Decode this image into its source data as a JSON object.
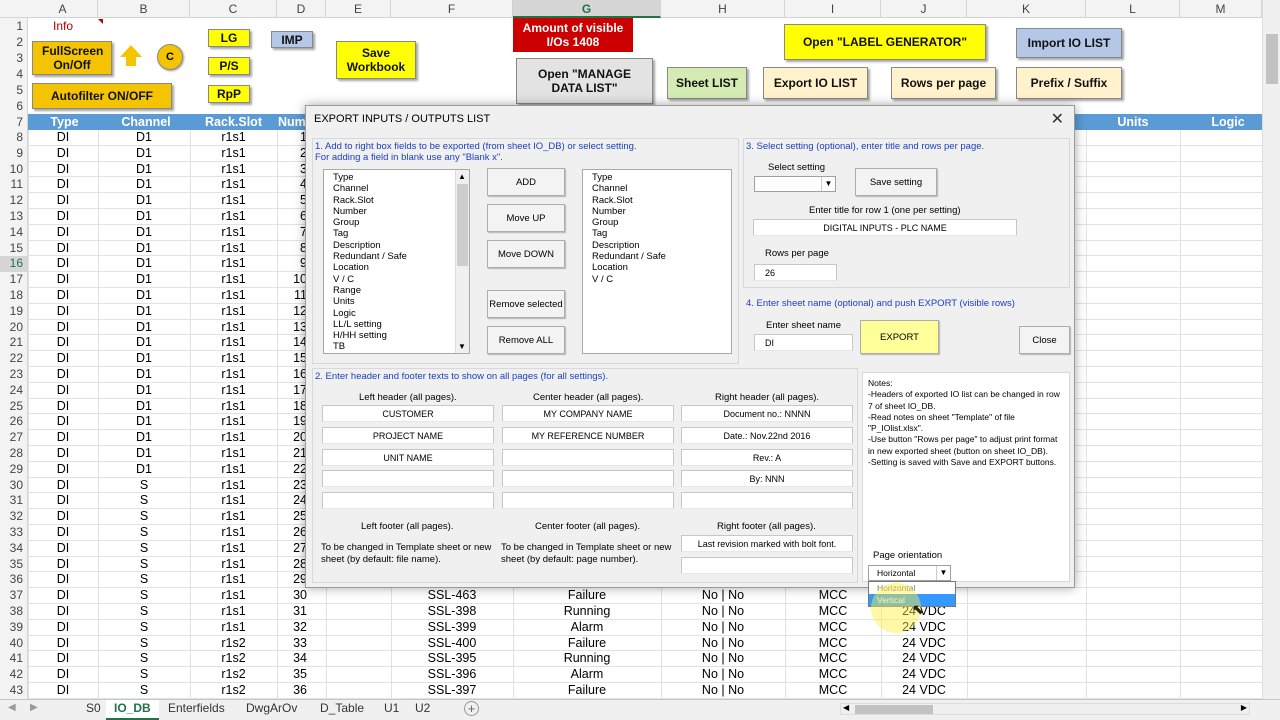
{
  "info_label": "Info",
  "columns": [
    "A",
    "B",
    "C",
    "D",
    "E",
    "F",
    "G",
    "H",
    "I",
    "J",
    "K",
    "L",
    "M"
  ],
  "selected_column": "G",
  "header_row": {
    "type": "Type",
    "channel": "Channel",
    "rack": "Rack.Slot",
    "num": "Num",
    "units": "Units",
    "logic": "Logic"
  },
  "top_buttons": {
    "fullscreen": "FullScreen On/Off",
    "autofilter": "Autofilter ON/OFF",
    "c": "C",
    "lg": "LG",
    "ps": "P/S",
    "rpp": "RpP",
    "imp": "IMP",
    "save": "Save Workbook",
    "amount": "Amount of visible I/Os 1408",
    "manage": "Open \"MANAGE DATA LIST\"",
    "sheetlist": "Sheet LIST",
    "exportlist": "Export IO LIST",
    "rowsperpage": "Rows per page",
    "prefix": "Prefix / Suffix",
    "labelgen": "Open \"LABEL GENERATOR\"",
    "importlist": "Import IO LIST"
  },
  "rows": [
    {
      "n": "8",
      "a": "DI",
      "b": "D1",
      "c": "r1s1",
      "d": "1"
    },
    {
      "n": "9",
      "a": "DI",
      "b": "D1",
      "c": "r1s1",
      "d": "2"
    },
    {
      "n": "10",
      "a": "DI",
      "b": "D1",
      "c": "r1s1",
      "d": "3"
    },
    {
      "n": "11",
      "a": "DI",
      "b": "D1",
      "c": "r1s1",
      "d": "4"
    },
    {
      "n": "12",
      "a": "DI",
      "b": "D1",
      "c": "r1s1",
      "d": "5"
    },
    {
      "n": "13",
      "a": "DI",
      "b": "D1",
      "c": "r1s1",
      "d": "6"
    },
    {
      "n": "14",
      "a": "DI",
      "b": "D1",
      "c": "r1s1",
      "d": "7"
    },
    {
      "n": "15",
      "a": "DI",
      "b": "D1",
      "c": "r1s1",
      "d": "8"
    },
    {
      "n": "16",
      "a": "DI",
      "b": "D1",
      "c": "r1s1",
      "d": "9"
    },
    {
      "n": "17",
      "a": "DI",
      "b": "D1",
      "c": "r1s1",
      "d": "10"
    },
    {
      "n": "18",
      "a": "DI",
      "b": "D1",
      "c": "r1s1",
      "d": "11"
    },
    {
      "n": "19",
      "a": "DI",
      "b": "D1",
      "c": "r1s1",
      "d": "12"
    },
    {
      "n": "20",
      "a": "DI",
      "b": "D1",
      "c": "r1s1",
      "d": "13"
    },
    {
      "n": "21",
      "a": "DI",
      "b": "D1",
      "c": "r1s1",
      "d": "14"
    },
    {
      "n": "22",
      "a": "DI",
      "b": "D1",
      "c": "r1s1",
      "d": "15"
    },
    {
      "n": "23",
      "a": "DI",
      "b": "D1",
      "c": "r1s1",
      "d": "16"
    },
    {
      "n": "24",
      "a": "DI",
      "b": "D1",
      "c": "r1s1",
      "d": "17"
    },
    {
      "n": "25",
      "a": "DI",
      "b": "D1",
      "c": "r1s1",
      "d": "18"
    },
    {
      "n": "26",
      "a": "DI",
      "b": "D1",
      "c": "r1s1",
      "d": "19"
    },
    {
      "n": "27",
      "a": "DI",
      "b": "D1",
      "c": "r1s1",
      "d": "20"
    },
    {
      "n": "28",
      "a": "DI",
      "b": "D1",
      "c": "r1s1",
      "d": "21"
    },
    {
      "n": "29",
      "a": "DI",
      "b": "D1",
      "c": "r1s1",
      "d": "22"
    },
    {
      "n": "30",
      "a": "DI",
      "b": "S",
      "c": "r1s1",
      "d": "23"
    },
    {
      "n": "31",
      "a": "DI",
      "b": "S",
      "c": "r1s1",
      "d": "24"
    },
    {
      "n": "32",
      "a": "DI",
      "b": "S",
      "c": "r1s1",
      "d": "25"
    },
    {
      "n": "33",
      "a": "DI",
      "b": "S",
      "c": "r1s1",
      "d": "26"
    },
    {
      "n": "34",
      "a": "DI",
      "b": "S",
      "c": "r1s1",
      "d": "27"
    },
    {
      "n": "35",
      "a": "DI",
      "b": "S",
      "c": "r1s1",
      "d": "28"
    },
    {
      "n": "36",
      "a": "DI",
      "b": "S",
      "c": "r1s1",
      "d": "29"
    },
    {
      "n": "37",
      "a": "DI",
      "b": "S",
      "c": "r1s1",
      "d": "30",
      "f": "SSL-463",
      "g": "Failure",
      "h": "No | No",
      "i": "MCC",
      "j": ""
    },
    {
      "n": "38",
      "a": "DI",
      "b": "S",
      "c": "r1s1",
      "d": "31",
      "f": "SSL-398",
      "g": "Running",
      "h": "No | No",
      "i": "MCC",
      "j": "24 VDC"
    },
    {
      "n": "39",
      "a": "DI",
      "b": "S",
      "c": "r1s1",
      "d": "32",
      "f": "SSL-399",
      "g": "Alarm",
      "h": "No | No",
      "i": "MCC",
      "j": "24 VDC"
    },
    {
      "n": "40",
      "a": "DI",
      "b": "S",
      "c": "r1s2",
      "d": "33",
      "f": "SSL-400",
      "g": "Failure",
      "h": "No | No",
      "i": "MCC",
      "j": "24 VDC"
    },
    {
      "n": "41",
      "a": "DI",
      "b": "S",
      "c": "r1s2",
      "d": "34",
      "f": "SSL-395",
      "g": "Running",
      "h": "No | No",
      "i": "MCC",
      "j": "24 VDC"
    },
    {
      "n": "42",
      "a": "DI",
      "b": "S",
      "c": "r1s2",
      "d": "35",
      "f": "SSL-396",
      "g": "Alarm",
      "h": "No | No",
      "i": "MCC",
      "j": "24 VDC"
    },
    {
      "n": "43",
      "a": "DI",
      "b": "S",
      "c": "r1s2",
      "d": "36",
      "f": "SSL-397",
      "g": "Failure",
      "h": "No | No",
      "i": "MCC",
      "j": "24 VDC"
    }
  ],
  "top_row_numbers": [
    "1",
    "2",
    "3",
    "4",
    "5",
    "6",
    "7"
  ],
  "dialog": {
    "title": "EXPORT INPUTS / OUTPUTS LIST",
    "step1": "1. Add to right box fields to be exported (from sheet IO_DB) or select setting.",
    "step1b": "For adding a field in blank use any \"Blank x\".",
    "left_fields": [
      "Type",
      "Channel",
      "Rack.Slot",
      "Number",
      "Group",
      "Tag",
      "Description",
      "Redundant / Safe",
      "Location",
      "V / C",
      "Range",
      "Units",
      "Logic",
      "LL/L setting",
      "H/HH setting",
      "TB"
    ],
    "right_fields": [
      "Type",
      "Channel",
      "Rack.Slot",
      "Number",
      "Group",
      "Tag",
      "Description",
      "Redundant / Safe",
      "Location",
      "V / C"
    ],
    "add": "ADD",
    "move_up": "Move UP",
    "move_down": "Move DOWN",
    "remove_sel": "Remove selected",
    "remove_all": "Remove ALL",
    "step3": "3. Select setting (optional), enter title and rows per page.",
    "select_setting": "Select setting",
    "save_setting": "Save setting",
    "title_label": "Enter title for row 1 (one per setting)",
    "title_value": "DIGITAL INPUTS - PLC NAME",
    "rows_label": "Rows per page",
    "rows_value": "26",
    "step4": "4. Enter sheet name (optional) and push EXPORT (visible rows)",
    "sheet_label": "Enter sheet name",
    "sheet_value": "DI",
    "export": "EXPORT",
    "close": "Close",
    "step2": "2. Enter header and footer texts to show on all pages (for all settings).",
    "left_header": "Left header (all pages).",
    "center_header": "Center header (all pages).",
    "right_header": "Right header (all pages).",
    "lh": [
      "CUSTOMER",
      "PROJECT NAME",
      "UNIT NAME",
      "",
      ""
    ],
    "ch": [
      "MY COMPANY NAME",
      "MY REFERENCE NUMBER",
      "",
      "",
      ""
    ],
    "rh": [
      "Document no.: NNNN",
      "Date.: Nov.22nd 2016",
      "Rev.: A",
      "By: NNN",
      ""
    ],
    "left_footer": "Left footer (all pages).",
    "center_footer": "Center footer (all pages).",
    "right_footer": "Right footer (all pages).",
    "lf_text": "To be changed in Template sheet or new sheet (by default: file name).",
    "cf_text": "To be changed in Template sheet or new sheet (by default: page number).",
    "rf": [
      "Last revision marked with bolt font.",
      ""
    ],
    "notes": "Notes:\n-Headers of exported IO list can be changed in row 7 of sheet IO_DB.\n-Read notes on sheet \"Template\" of file \"P_IOlist.xlsx\".\n-Use button \"Rows per page\" to adjust print format in new exported sheet (button on sheet IO_DB).\n-Setting is saved with Save and EXPORT buttons.",
    "orientation_label": "Page orientation",
    "orientation_value": "Horizontal",
    "orientation_options": [
      "Horizontal",
      "Vertical"
    ]
  },
  "tabs": [
    "S0",
    "IO_DB",
    "Enterfields",
    "DwgArOv",
    "D_Table",
    "U1",
    "U2"
  ],
  "active_tab": "IO_DB"
}
